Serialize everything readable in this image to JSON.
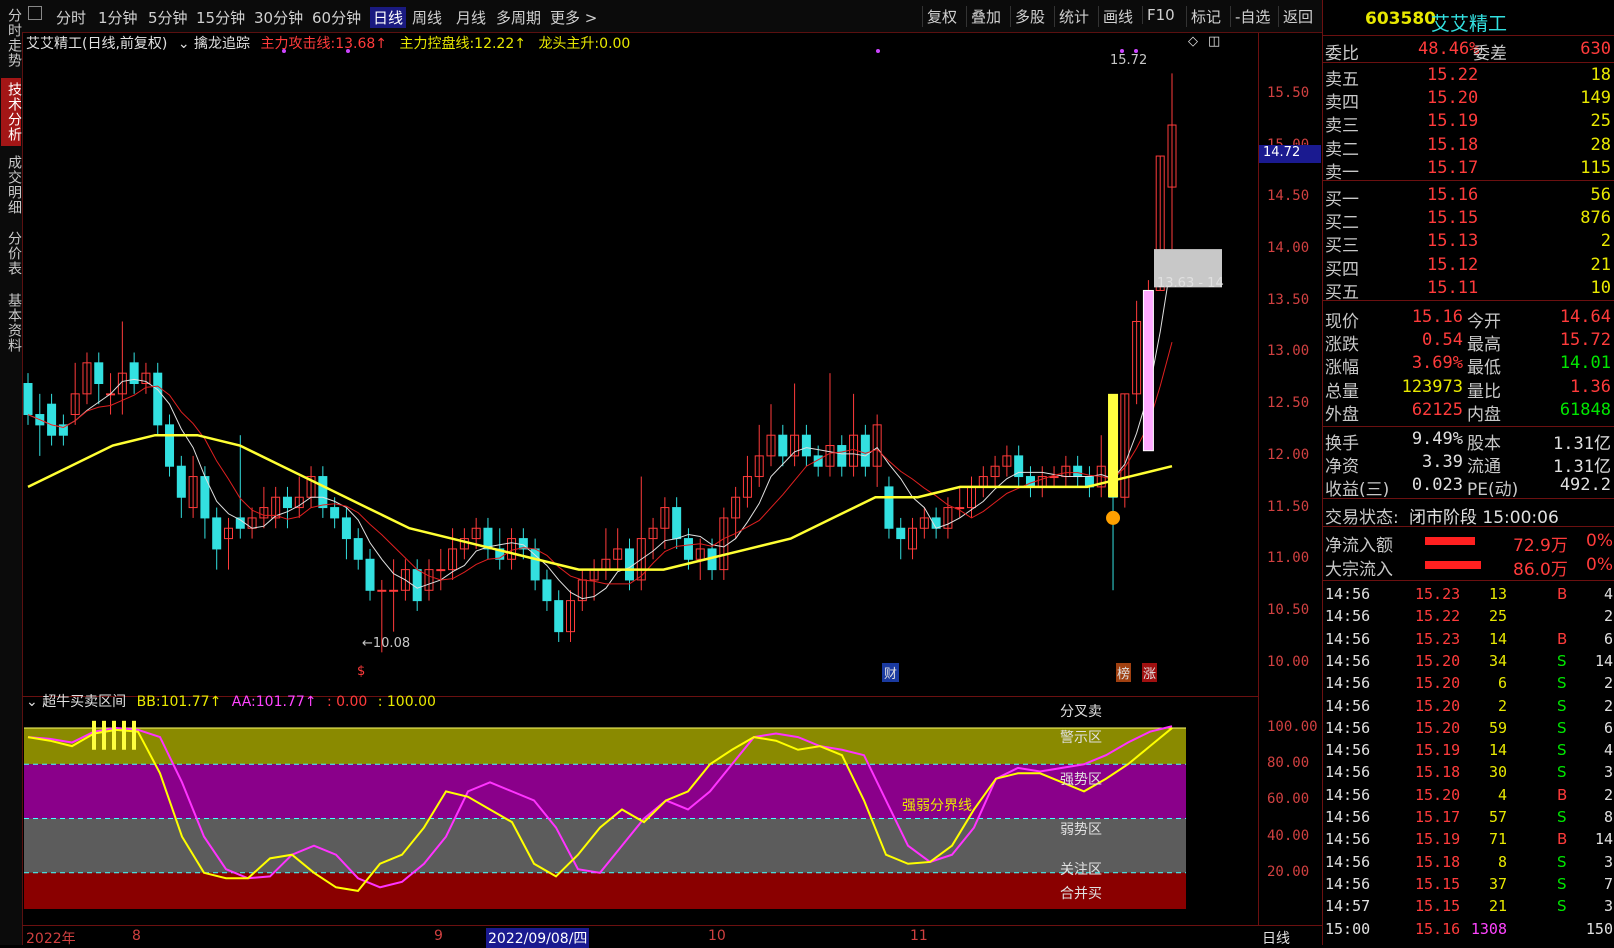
{
  "left_tabs": [
    {
      "label": "分时走势",
      "active": false
    },
    {
      "label": "技术分析",
      "active": true
    },
    {
      "label": "成交明细",
      "active": false
    },
    {
      "label": "分价表",
      "active": false
    },
    {
      "label": "基本资料",
      "active": false
    }
  ],
  "toolbar": {
    "periods": [
      "分时",
      "1分钟",
      "5分钟",
      "15分钟",
      "30分钟",
      "60分钟",
      "日线",
      "周线",
      "月线",
      "多周期",
      "更多 >"
    ],
    "active_period": "日线",
    "right_buttons": [
      "复权",
      "叠加",
      "多股",
      "统计",
      "画线",
      "F10",
      "标记",
      "-自选",
      "返回"
    ]
  },
  "main_header": {
    "stock": "艾艾精工(日线,前复权)",
    "indicator": "擒龙追踪",
    "line1_label": "主力攻击线:",
    "line1_value": "13.68↑",
    "line2_label": "主力控盘线:",
    "line2_value": "12.22↑",
    "line3_label": "龙头主升:",
    "line3_value": "0.00"
  },
  "main_annotations": {
    "high_marker": "15.72",
    "low_marker": "←10.08",
    "current_price_tag": "14.72",
    "zone_label": "13.63 - 14",
    "event_s": "$",
    "event_cai": "财",
    "event_bang": "榜",
    "event_zhang": "涨"
  },
  "ind_header": {
    "name": "超牛买卖区间",
    "bb_label": "BB:",
    "bb_value": "101.77↑",
    "aa_label": "AA:",
    "aa_value": "101.77↑",
    "v3": ": 0.00",
    "v4": ": 100.00"
  },
  "ind_zones": {
    "z1": "分叉卖",
    "z2": "警示区",
    "z3": "强势区",
    "z4": "弱势区",
    "z5": "关注区",
    "z6": "合并买",
    "mid": "强弱分界线"
  },
  "y_axis_main": [
    "15.50",
    "15.00",
    "14.50",
    "14.00",
    "13.50",
    "13.00",
    "12.50",
    "12.00",
    "11.50",
    "11.00",
    "10.50",
    "10.00"
  ],
  "y_axis_ind": [
    "100.00",
    "80.00",
    "60.00",
    "40.00",
    "20.00"
  ],
  "x_axis": {
    "labels": [
      "2022年",
      "8",
      "9",
      "2022/09/08/四",
      "10",
      "11"
    ],
    "period": "日线"
  },
  "quote": {
    "code": "603580",
    "name": "艾艾精工",
    "weibi_label": "委比",
    "weibi": "48.46%",
    "weicha_label": "委差",
    "weicha": "630",
    "sells": [
      {
        "label": "卖五",
        "price": "15.22",
        "vol": "18"
      },
      {
        "label": "卖四",
        "price": "15.20",
        "vol": "149"
      },
      {
        "label": "卖三",
        "price": "15.19",
        "vol": "25"
      },
      {
        "label": "卖二",
        "price": "15.18",
        "vol": "28"
      },
      {
        "label": "卖一",
        "price": "15.17",
        "vol": "115"
      }
    ],
    "buys": [
      {
        "label": "买一",
        "price": "15.16",
        "vol": "56"
      },
      {
        "label": "买二",
        "price": "15.15",
        "vol": "876"
      },
      {
        "label": "买三",
        "price": "15.13",
        "vol": "2"
      },
      {
        "label": "买四",
        "price": "15.12",
        "vol": "21"
      },
      {
        "label": "买五",
        "price": "15.11",
        "vol": "10"
      }
    ],
    "stats": [
      {
        "l1": "现价",
        "v1": "15.16",
        "l2": "今开",
        "v2": "14.64",
        "c1": "red",
        "c2": "red"
      },
      {
        "l1": "涨跌",
        "v1": "0.54",
        "l2": "最高",
        "v2": "15.72",
        "c1": "red",
        "c2": "red"
      },
      {
        "l1": "涨幅",
        "v1": "3.69%",
        "l2": "最低",
        "v2": "14.01",
        "c1": "red",
        "c2": "green"
      },
      {
        "l1": "总量",
        "v1": "123973",
        "l2": "量比",
        "v2": "1.36",
        "c1": "yellow",
        "c2": "red"
      },
      {
        "l1": "外盘",
        "v1": "62125",
        "l2": "内盘",
        "v2": "61848",
        "c1": "red",
        "c2": "green"
      }
    ],
    "stats2": [
      {
        "l1": "换手",
        "v1": "9.49%",
        "l2": "股本",
        "v2": "1.31亿"
      },
      {
        "l1": "净资",
        "v1": "3.39",
        "l2": "流通",
        "v2": "1.31亿"
      },
      {
        "l1": "收益(三)",
        "v1": "0.023",
        "l2": "PE(动)",
        "v2": "492.2"
      }
    ],
    "trade_state_label": "交易状态:",
    "trade_state": "闭市阶段 15:00:06",
    "net_inflow_label": "净流入额",
    "net_inflow": "72.9万",
    "net_inflow_pct": "0%",
    "big_inflow_label": "大宗流入",
    "big_inflow": "86.0万",
    "big_inflow_pct": "0%",
    "ticks": [
      {
        "t": "14:56",
        "p": "15.23",
        "v": "13",
        "d": "B",
        "n": "4"
      },
      {
        "t": "14:56",
        "p": "15.22",
        "v": "25",
        "d": "",
        "n": "2"
      },
      {
        "t": "14:56",
        "p": "15.23",
        "v": "14",
        "d": "B",
        "n": "6"
      },
      {
        "t": "14:56",
        "p": "15.20",
        "v": "34",
        "d": "S",
        "n": "14"
      },
      {
        "t": "14:56",
        "p": "15.20",
        "v": "6",
        "d": "S",
        "n": "2"
      },
      {
        "t": "14:56",
        "p": "15.20",
        "v": "2",
        "d": "S",
        "n": "2"
      },
      {
        "t": "14:56",
        "p": "15.20",
        "v": "59",
        "d": "S",
        "n": "6"
      },
      {
        "t": "14:56",
        "p": "15.19",
        "v": "14",
        "d": "S",
        "n": "4"
      },
      {
        "t": "14:56",
        "p": "15.18",
        "v": "30",
        "d": "S",
        "n": "3"
      },
      {
        "t": "14:56",
        "p": "15.20",
        "v": "4",
        "d": "B",
        "n": "2"
      },
      {
        "t": "14:56",
        "p": "15.17",
        "v": "57",
        "d": "S",
        "n": "8"
      },
      {
        "t": "14:56",
        "p": "15.19",
        "v": "71",
        "d": "B",
        "n": "14"
      },
      {
        "t": "14:56",
        "p": "15.18",
        "v": "8",
        "d": "S",
        "n": "3"
      },
      {
        "t": "14:56",
        "p": "15.15",
        "v": "37",
        "d": "S",
        "n": "7"
      },
      {
        "t": "14:57",
        "p": "15.15",
        "v": "21",
        "d": "S",
        "n": "3"
      },
      {
        "t": "15:00",
        "p": "15.16",
        "v": "1308",
        "d": "",
        "n": "150"
      }
    ]
  },
  "colors": {
    "up": "#ff3b3b",
    "down": "#33e0e0",
    "ma_yellow": "#ffff33",
    "ma_white": "#e0e0e0",
    "ma_red": "#e02020",
    "ind_yellow": "#ffff00",
    "ind_magenta": "#ff33ff",
    "zone_warn": "#8a8a00",
    "zone_strong": "#8a008a",
    "zone_weak": "#5c5c5c",
    "zone_focus": "#8a0000"
  },
  "chart_data": {
    "type": "candlestick",
    "ylim": [
      9.9,
      15.8
    ],
    "candles": [
      [
        12.7,
        12.4,
        12.8,
        12.3
      ],
      [
        12.4,
        12.3,
        12.6,
        12.0
      ],
      [
        12.5,
        12.2,
        12.6,
        12.1
      ],
      [
        12.3,
        12.2,
        12.4,
        12.1
      ],
      [
        12.4,
        12.6,
        12.9,
        12.3
      ],
      [
        12.6,
        12.9,
        13.0,
        12.5
      ],
      [
        12.9,
        12.7,
        13.0,
        12.5
      ],
      [
        12.6,
        12.6,
        12.8,
        12.4
      ],
      [
        12.6,
        12.8,
        13.3,
        12.4
      ],
      [
        12.9,
        12.7,
        13.0,
        12.6
      ],
      [
        12.7,
        12.8,
        12.9,
        12.6
      ],
      [
        12.8,
        12.3,
        12.9,
        12.2
      ],
      [
        12.3,
        11.9,
        12.4,
        11.8
      ],
      [
        11.9,
        11.6,
        12.0,
        11.4
      ],
      [
        11.5,
        11.8,
        12.0,
        11.4
      ],
      [
        11.8,
        11.4,
        11.9,
        11.2
      ],
      [
        11.4,
        11.1,
        11.5,
        10.9
      ],
      [
        11.2,
        11.3,
        11.4,
        10.9
      ],
      [
        11.4,
        11.3,
        12.2,
        11.2
      ],
      [
        11.3,
        11.4,
        11.5,
        11.2
      ],
      [
        11.4,
        11.5,
        11.7,
        11.3
      ],
      [
        11.4,
        11.6,
        11.7,
        11.3
      ],
      [
        11.6,
        11.5,
        11.7,
        11.3
      ],
      [
        11.5,
        11.6,
        11.8,
        11.4
      ],
      [
        11.6,
        11.8,
        11.9,
        11.5
      ],
      [
        11.8,
        11.5,
        11.9,
        11.4
      ],
      [
        11.5,
        11.4,
        11.6,
        11.3
      ],
      [
        11.4,
        11.2,
        11.5,
        11.0
      ],
      [
        11.2,
        11.0,
        11.3,
        10.9
      ],
      [
        11.0,
        10.7,
        11.1,
        10.6
      ],
      [
        10.7,
        10.7,
        10.8,
        10.1
      ],
      [
        10.7,
        10.7,
        11.0,
        10.3
      ],
      [
        10.7,
        10.9,
        11.0,
        10.6
      ],
      [
        10.9,
        10.6,
        11.0,
        10.5
      ],
      [
        10.7,
        10.9,
        11.0,
        10.6
      ],
      [
        10.9,
        10.9,
        11.1,
        10.7
      ],
      [
        10.9,
        11.1,
        11.3,
        10.8
      ],
      [
        11.1,
        11.2,
        11.3,
        11.0
      ],
      [
        11.2,
        11.3,
        11.4,
        11.1
      ],
      [
        11.3,
        11.1,
        11.4,
        11.0
      ],
      [
        11.1,
        11.0,
        11.3,
        10.9
      ],
      [
        11.0,
        11.2,
        11.3,
        10.9
      ],
      [
        11.2,
        11.1,
        11.3,
        11.0
      ],
      [
        11.1,
        10.8,
        11.2,
        10.7
      ],
      [
        10.8,
        10.6,
        10.9,
        10.5
      ],
      [
        10.6,
        10.3,
        10.7,
        10.2
      ],
      [
        10.3,
        10.6,
        10.7,
        10.2
      ],
      [
        10.6,
        10.8,
        10.9,
        10.5
      ],
      [
        10.8,
        10.9,
        11.0,
        10.6
      ],
      [
        10.9,
        11.0,
        11.3,
        10.8
      ],
      [
        11.0,
        11.1,
        11.3,
        10.9
      ],
      [
        11.1,
        10.8,
        11.2,
        10.7
      ],
      [
        10.8,
        11.2,
        11.8,
        10.7
      ],
      [
        11.2,
        11.3,
        11.4,
        11.0
      ],
      [
        11.3,
        11.5,
        11.6,
        11.1
      ],
      [
        11.5,
        11.2,
        11.6,
        11.1
      ],
      [
        11.2,
        11.0,
        11.3,
        10.9
      ],
      [
        11.0,
        11.1,
        11.2,
        10.8
      ],
      [
        11.1,
        10.9,
        11.2,
        10.8
      ],
      [
        10.9,
        11.4,
        11.5,
        10.8
      ],
      [
        11.4,
        11.6,
        11.7,
        11.2
      ],
      [
        11.6,
        11.8,
        12.0,
        11.5
      ],
      [
        11.8,
        12.0,
        12.3,
        11.7
      ],
      [
        12.0,
        12.2,
        12.5,
        11.9
      ],
      [
        12.2,
        12.0,
        12.3,
        11.9
      ],
      [
        12.0,
        12.2,
        12.7,
        11.9
      ],
      [
        12.2,
        12.0,
        12.3,
        11.9
      ],
      [
        12.0,
        11.9,
        12.1,
        11.8
      ],
      [
        11.9,
        12.1,
        12.8,
        11.8
      ],
      [
        12.1,
        11.9,
        12.2,
        11.8
      ],
      [
        11.9,
        12.2,
        12.6,
        11.8
      ],
      [
        12.2,
        11.9,
        12.3,
        11.8
      ],
      [
        11.9,
        12.3,
        12.4,
        11.7
      ],
      [
        11.7,
        11.3,
        11.8,
        11.2
      ],
      [
        11.3,
        11.2,
        11.4,
        11.0
      ],
      [
        11.1,
        11.3,
        11.4,
        11.0
      ],
      [
        11.3,
        11.4,
        11.5,
        11.2
      ],
      [
        11.4,
        11.3,
        11.5,
        11.2
      ],
      [
        11.3,
        11.5,
        11.6,
        11.2
      ],
      [
        11.5,
        11.5,
        11.7,
        11.4
      ],
      [
        11.5,
        11.7,
        11.8,
        11.4
      ],
      [
        11.7,
        11.8,
        11.9,
        11.6
      ],
      [
        11.8,
        11.9,
        12.0,
        11.7
      ],
      [
        11.9,
        12.0,
        12.1,
        11.8
      ],
      [
        12.0,
        11.8,
        12.1,
        11.7
      ],
      [
        11.8,
        11.7,
        11.9,
        11.6
      ],
      [
        11.7,
        11.8,
        11.9,
        11.6
      ],
      [
        11.8,
        11.8,
        11.9,
        11.7
      ],
      [
        11.8,
        11.9,
        12.0,
        11.7
      ],
      [
        11.9,
        11.8,
        12.0,
        11.7
      ],
      [
        11.8,
        11.7,
        11.9,
        11.6
      ],
      [
        11.7,
        11.9,
        12.2,
        11.6
      ],
      [
        11.9,
        11.6,
        12.0,
        10.7
      ],
      [
        11.6,
        12.6,
        12.6,
        11.5
      ],
      [
        12.6,
        13.3,
        13.5,
        12.5
      ],
      [
        12.5,
        13.6,
        13.7,
        12.5
      ],
      [
        13.6,
        14.9,
        14.9,
        13.6
      ],
      [
        14.6,
        15.2,
        15.7,
        14.0
      ]
    ],
    "ma_yellow": [
      11.7,
      11.9,
      12.1,
      12.2,
      12.2,
      12.1,
      11.9,
      11.7,
      11.5,
      11.3,
      11.2,
      11.1,
      11.0,
      10.9,
      10.9,
      10.9,
      11.0,
      11.1,
      11.2,
      11.4,
      11.6,
      11.6,
      11.7,
      11.7,
      11.7,
      11.7,
      11.8,
      11.9
    ],
    "indicator": {
      "ylim": [
        0,
        105
      ],
      "yellow": [
        95,
        93,
        90,
        97,
        99,
        98,
        75,
        40,
        20,
        17,
        17,
        28,
        30,
        20,
        12,
        10,
        25,
        30,
        45,
        65,
        62,
        55,
        48,
        25,
        18,
        30,
        45,
        55,
        48,
        60,
        65,
        80,
        88,
        95,
        93,
        88,
        90,
        85,
        60,
        30,
        25,
        26,
        35,
        55,
        72,
        75,
        75,
        70,
        65,
        72,
        80,
        90,
        100
      ],
      "magenta": [
        95,
        94,
        92,
        98,
        100,
        99,
        95,
        70,
        40,
        22,
        17,
        18,
        30,
        35,
        30,
        17,
        12,
        15,
        25,
        40,
        65,
        70,
        65,
        60,
        45,
        22,
        20,
        35,
        50,
        60,
        55,
        65,
        80,
        95,
        97,
        95,
        90,
        88,
        85,
        60,
        35,
        26,
        30,
        45,
        72,
        78,
        76,
        78,
        80,
        85,
        92,
        98,
        101
      ]
    }
  }
}
